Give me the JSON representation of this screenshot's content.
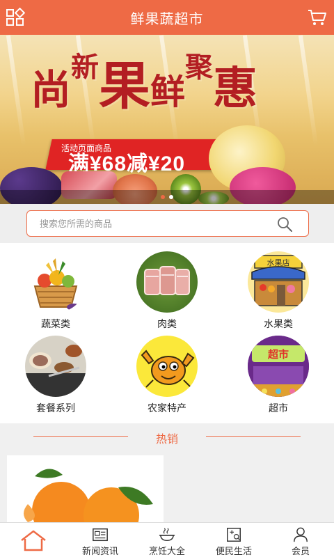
{
  "header": {
    "title": "鲜果蔬超市"
  },
  "banner": {
    "headline_chars": [
      "尚",
      "新",
      "果",
      "鲜",
      "聚",
      "惠"
    ],
    "promo_tag": "活动页面商品",
    "promo_main": "满¥68减¥20",
    "slide_count": 2,
    "active_slide": 1
  },
  "search": {
    "placeholder": "搜索您所需的商品"
  },
  "categories": [
    {
      "label": "蔬菜类",
      "icon": "vegetable-basket-icon"
    },
    {
      "label": "肉类",
      "icon": "meat-icon"
    },
    {
      "label": "水果类",
      "icon": "fruit-store-icon"
    },
    {
      "label": "套餐系列",
      "icon": "set-meal-icon"
    },
    {
      "label": "农家特产",
      "icon": "crab-mascot-icon"
    },
    {
      "label": "超市",
      "icon": "supermarket-icon"
    }
  ],
  "hot": {
    "title": "热销"
  },
  "tabbar": [
    {
      "label": "",
      "icon": "home-icon"
    },
    {
      "label": "新闻资讯",
      "icon": "news-icon"
    },
    {
      "label": "烹饪大全",
      "icon": "cooking-icon"
    },
    {
      "label": "便民生活",
      "icon": "life-service-icon"
    },
    {
      "label": "会员",
      "icon": "member-icon"
    }
  ],
  "colors": {
    "accent": "#ee6a45",
    "promo_red": "#e02424",
    "headline_red": "#b31e22"
  }
}
